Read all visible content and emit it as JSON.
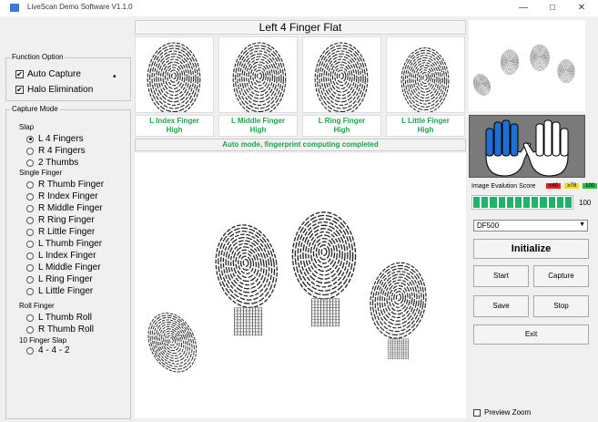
{
  "window": {
    "title": "LiveScan Demo Software V1.1.0",
    "minimize": "—",
    "maximize": "□",
    "close": "✕"
  },
  "function_option": {
    "title": "Function Option",
    "auto_capture": {
      "label": "Auto Capture",
      "checked": true
    },
    "halo_elimination": {
      "label": "Halo Elimination",
      "checked": true
    }
  },
  "capture_mode": {
    "title": "Capture Mode",
    "slap": {
      "label": "Slap",
      "options": [
        "L 4 Fingers",
        "R 4 Fingers",
        "2 Thumbs"
      ],
      "selected": 0
    },
    "single": {
      "label": "Single Finger",
      "options": [
        "R Thumb Finger",
        "R Index Finger",
        "R Middle Finger",
        "R Ring Finger",
        "R Little Finger",
        "L Thumb Finger",
        "L Index Finger",
        "L Middle Finger",
        "L Ring Finger",
        "L Little Finger"
      ]
    },
    "roll": {
      "label": "Roll Finger",
      "options": [
        "L Thumb Roll",
        "R Thumb Roll"
      ]
    },
    "ten": {
      "label": "10 Finger Slap",
      "options": [
        "4 - 4 - 2"
      ]
    }
  },
  "center": {
    "heading": "Left 4 Finger Flat",
    "fingers": [
      {
        "name": "L Index Finger",
        "quality": "High"
      },
      {
        "name": "L Middle Finger",
        "quality": "High"
      },
      {
        "name": "L Ring Finger",
        "quality": "High"
      },
      {
        "name": "L Little Finger",
        "quality": "High"
      }
    ],
    "status": "Auto mode, fingerprint computing completed"
  },
  "right": {
    "score_label": "Image Evalution Score",
    "score_legend": [
      {
        "text": "<40",
        "color": "#e02020"
      },
      {
        "text": "≥78",
        "color": "#f0e020"
      },
      {
        "text": "100",
        "color": "#20c040"
      }
    ],
    "score_value": "100",
    "score_fraction": 1.0,
    "device": "DF500",
    "buttons": {
      "initialize": "Initialize",
      "start": "Start",
      "capture": "Capture",
      "save": "Save",
      "stop": "Stop",
      "exit": "Exit"
    },
    "preview_zoom": {
      "label": "Preview Zoom",
      "checked": false
    },
    "colors": {
      "finger_highlight": "#1e6fd0",
      "hand_bg": "#7a7a7a",
      "score_bar": "#1db36a"
    }
  }
}
